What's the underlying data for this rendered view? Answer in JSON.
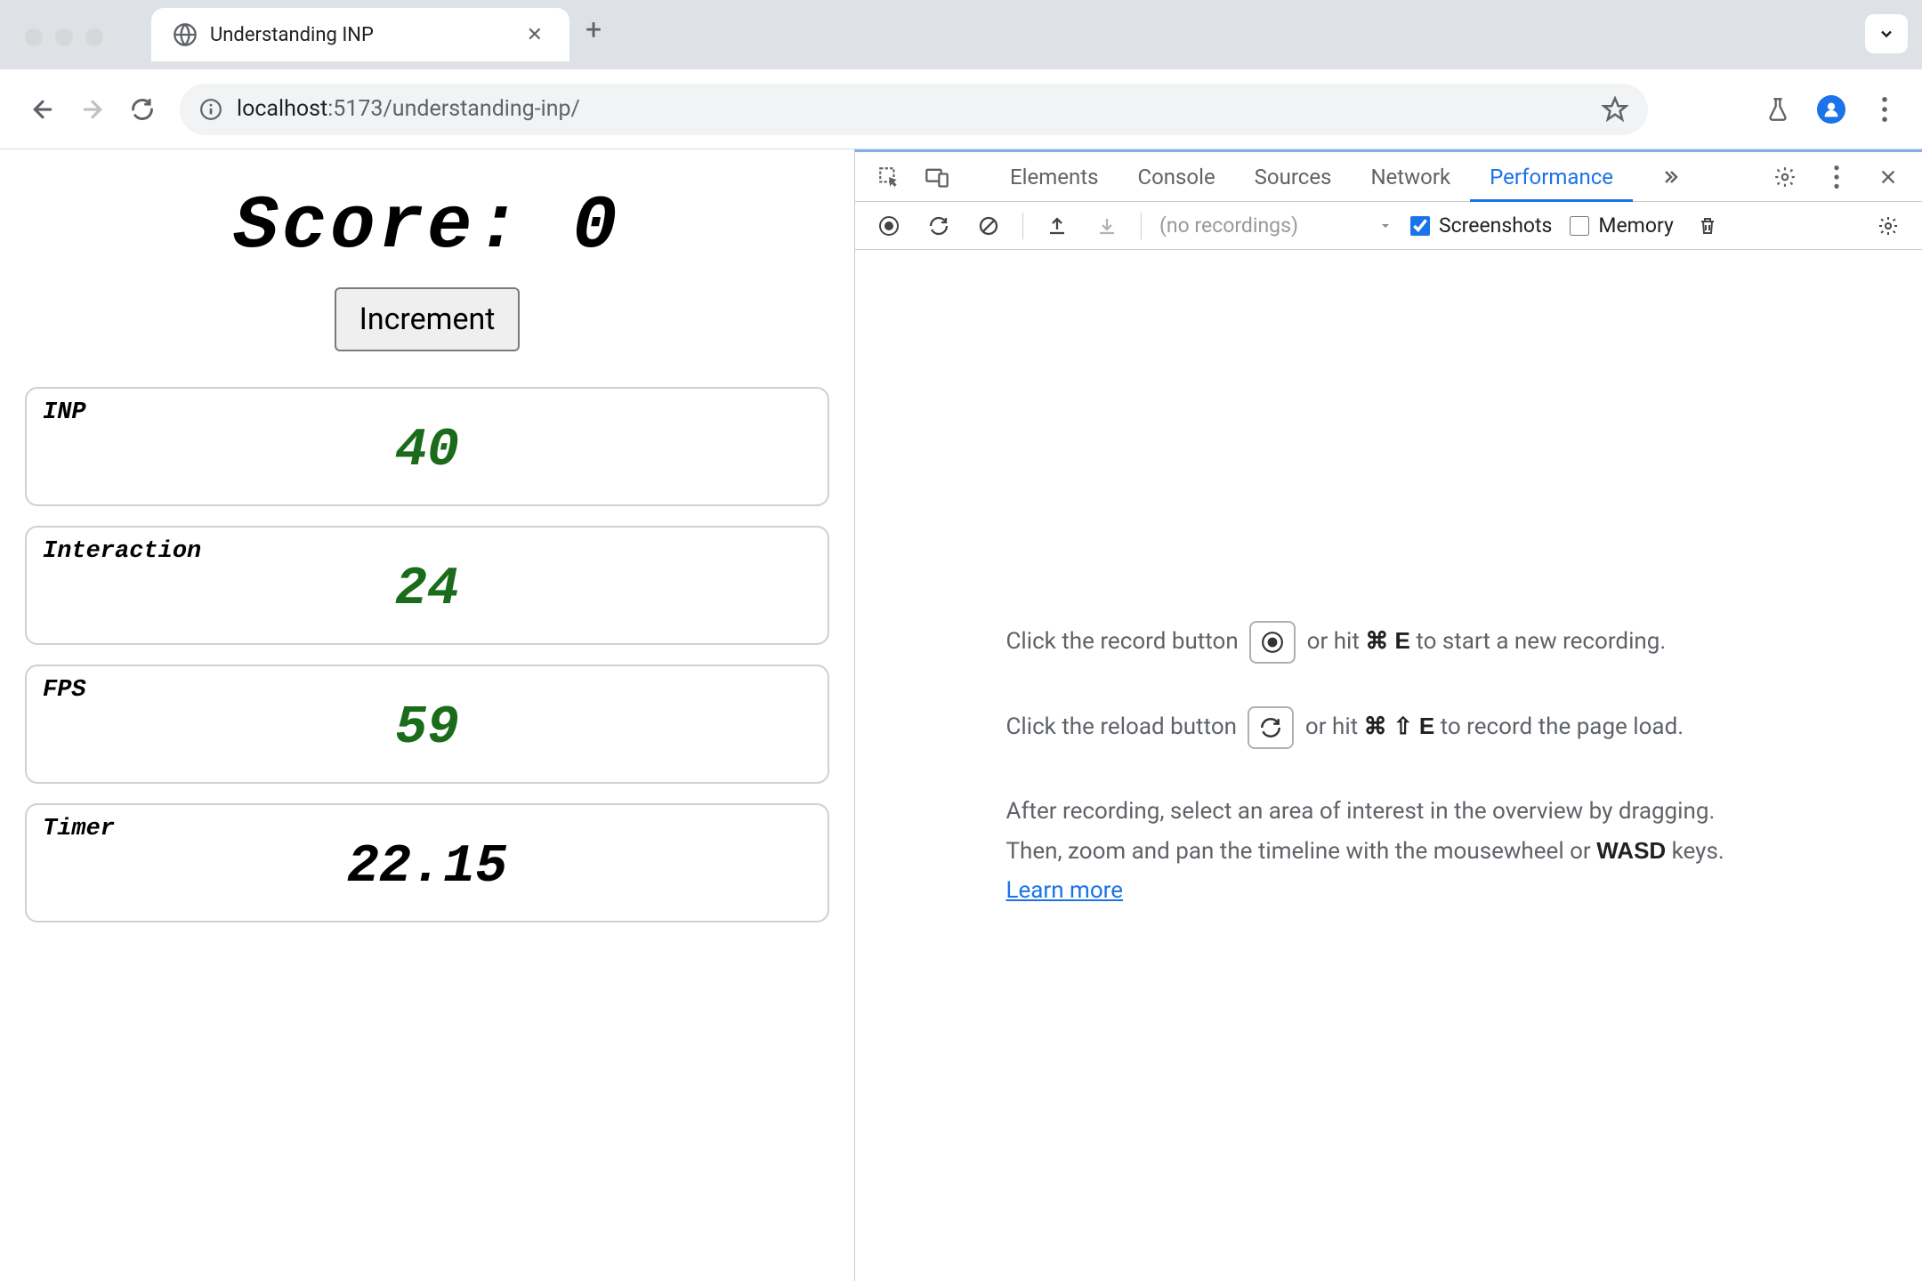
{
  "browser": {
    "tab_title": "Understanding INP",
    "url_host": "localhost",
    "url_port_path": ":5173/understanding-inp/"
  },
  "page": {
    "score_label": "Score: 0",
    "increment_label": "Increment",
    "metrics": {
      "inp": {
        "label": "INP",
        "value": "40"
      },
      "interaction": {
        "label": "Interaction",
        "value": "24"
      },
      "fps": {
        "label": "FPS",
        "value": "59"
      },
      "timer": {
        "label": "Timer",
        "value": "22.15"
      }
    }
  },
  "devtools": {
    "tabs": {
      "elements": "Elements",
      "console": "Console",
      "sources": "Sources",
      "network": "Network",
      "performance": "Performance"
    },
    "perf_bar": {
      "no_recordings": "(no recordings)",
      "screenshots": "Screenshots",
      "memory": "Memory"
    },
    "help": {
      "line1_a": "Click the record button ",
      "line1_b": " or hit ",
      "line1_kbd": "⌘ E",
      "line1_c": " to start a new recording.",
      "line2_a": "Click the reload button ",
      "line2_b": " or hit ",
      "line2_kbd": "⌘ ⇧ E",
      "line2_c": " to record the page load.",
      "line3_a": "After recording, select an area of interest in the overview by dragging. Then, zoom and pan the timeline with the mousewheel or ",
      "line3_kbd": "WASD",
      "line3_b": " keys. ",
      "learn_more": "Learn more"
    }
  }
}
